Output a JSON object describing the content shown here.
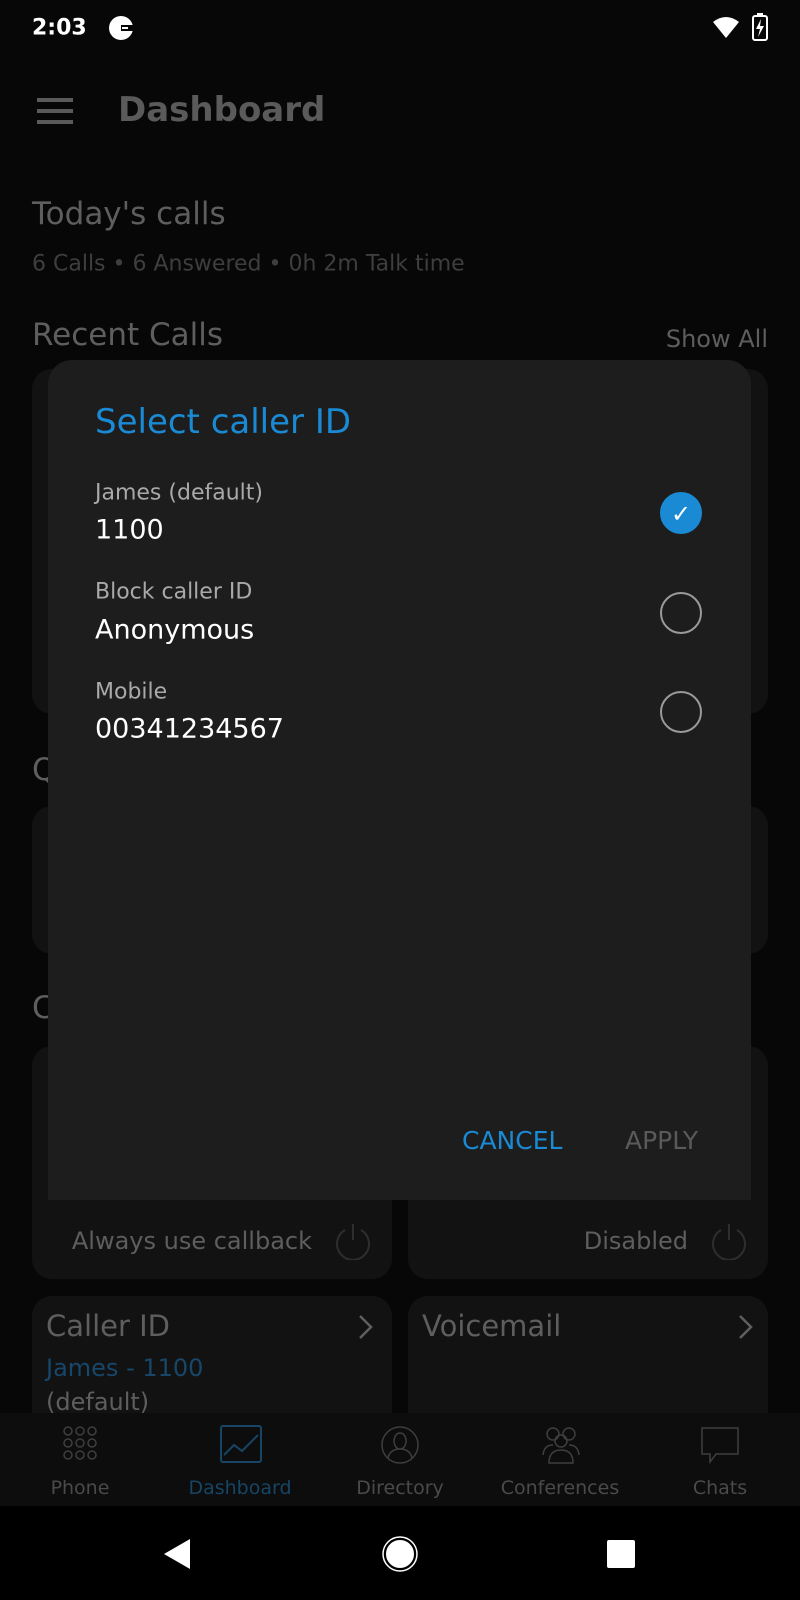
{
  "status_bar": {
    "time": "2:03",
    "app_icon": "g-circle-icon",
    "wifi_icon": "wifi-icon",
    "battery_icon": "battery-charging-icon"
  },
  "header": {
    "title": "Dashboard",
    "menu_icon": "hamburger-icon"
  },
  "todays_calls": {
    "title": "Today's calls",
    "summary": "6 Calls • 6 Answered • 0h 2m Talk time"
  },
  "recent_calls": {
    "title": "Recent Calls",
    "show_all": "Show All"
  },
  "sections": {
    "q_partial": "Q",
    "c_partial": "C"
  },
  "tiles": {
    "callback": {
      "status": "Always use callback"
    },
    "forwarding": {
      "status": "Disabled"
    },
    "caller_id": {
      "title": "Caller ID",
      "value": "James - 1100",
      "note": "(default)"
    },
    "voicemail": {
      "title": "Voicemail"
    }
  },
  "bottom_nav": {
    "active": "Dashboard",
    "items": [
      {
        "label": "Phone"
      },
      {
        "label": "Dashboard"
      },
      {
        "label": "Directory"
      },
      {
        "label": "Conferences"
      },
      {
        "label": "Chats"
      }
    ]
  },
  "dialog": {
    "title": "Select caller ID",
    "options": [
      {
        "label": "James (default)",
        "value": "1100",
        "selected": true
      },
      {
        "label": "Block caller ID",
        "value": "Anonymous",
        "selected": false
      },
      {
        "label": "Mobile",
        "value": "00341234567",
        "selected": false
      }
    ],
    "check_mark": "✓",
    "cancel": "CANCEL",
    "apply": "APPLY"
  },
  "colors": {
    "accent": "#1a8ad4",
    "dialog_bg": "#1d1d1d",
    "background": "#070707"
  }
}
